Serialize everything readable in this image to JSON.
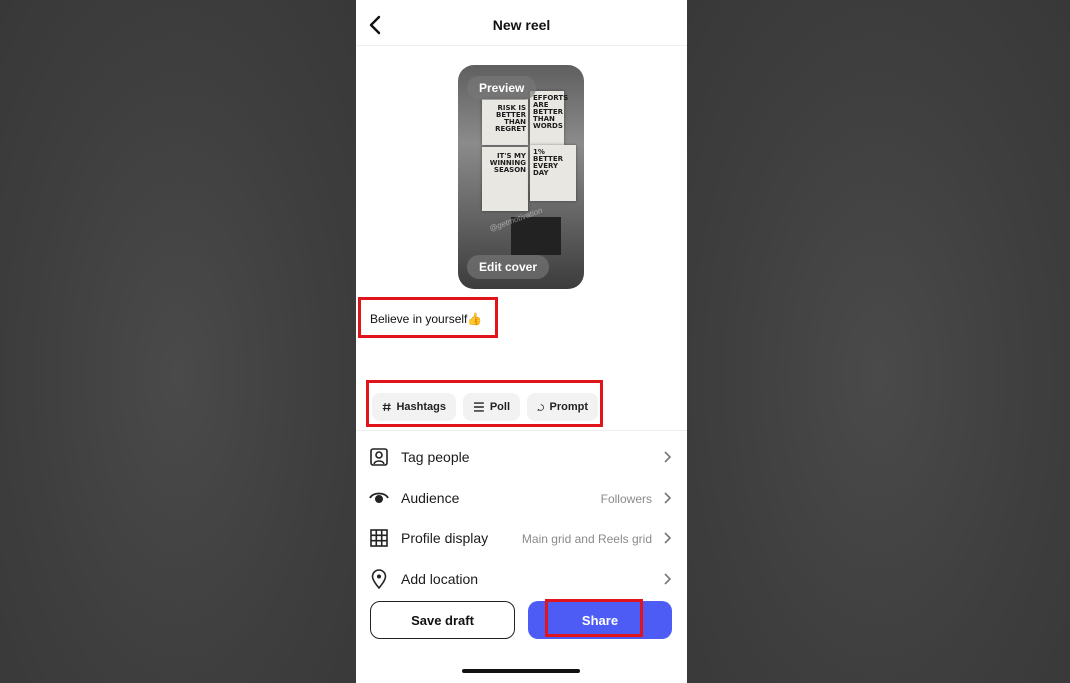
{
  "header": {
    "title": "New reel"
  },
  "preview": {
    "preview_label": "Preview",
    "edit_cover_label": "Edit cover",
    "posters": [
      "RISK IS BETTER THAN REGRET",
      "EFFORTS ARE BETTER THAN WORDS",
      "IT'S MY WINNING SEASON",
      "1% BETTER EVERY DAY"
    ],
    "watermark": "@getmotivation"
  },
  "caption": {
    "text": "Believe in yourself👍"
  },
  "chips": [
    {
      "label": "Hashtags",
      "icon": "hashtag-icon"
    },
    {
      "label": "Poll",
      "icon": "list-icon"
    },
    {
      "label": "Prompt",
      "icon": "chat-bubble-icon"
    }
  ],
  "settings": [
    {
      "label": "Tag people",
      "value": "",
      "icon": "tag-person-icon"
    },
    {
      "label": "Audience",
      "value": "Followers",
      "icon": "eye-icon"
    },
    {
      "label": "Profile display",
      "value": "Main grid and Reels grid",
      "icon": "grid-icon"
    },
    {
      "label": "Add location",
      "value": "",
      "icon": "location-pin-icon"
    }
  ],
  "actions": {
    "save_draft": "Save draft",
    "share": "Share"
  },
  "colors": {
    "share_button": "#4c5cf5",
    "highlight": "#e0141b"
  }
}
